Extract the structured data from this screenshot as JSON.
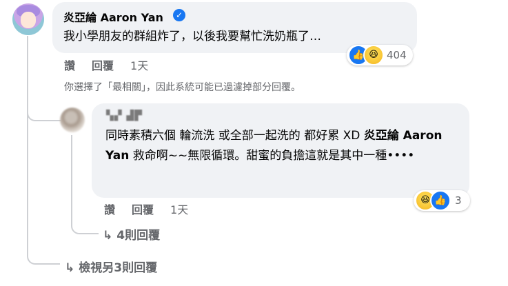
{
  "comment1": {
    "author": "炎亞綸 Aaron Yan",
    "text": "我小學朋友的群組炸了，以後我要幫忙洗奶瓶了…",
    "reaction_count": "404",
    "actions": {
      "like": "讚",
      "reply": "回覆",
      "time": "1天"
    }
  },
  "notice": "你選擇了「最相關」，因此系統可能已過濾掉部分回覆。",
  "comment2": {
    "author": "​",
    "text_part1": "同時素積六個 輪流洗 或全部一起洗的 都好累 XD ",
    "tag": "炎亞綸 Aaron Yan",
    "text_part2": " 救命啊~~無限循環。甜蜜的負擔這就是其中一種••••",
    "reaction_count": "3",
    "actions": {
      "like": "讚",
      "reply": "回覆",
      "time": "1天"
    }
  },
  "replies_link": "4則回覆",
  "view_more_link": "檢視另3則回覆",
  "colors": {
    "like_blue": "#1877f2",
    "muted": "#65676b",
    "bubble": "#f0f2f5"
  },
  "icons": {
    "like": "thumbs-up-icon",
    "haha": "haha-icon",
    "verified": "verified-badge-icon",
    "reply_arrow": "reply-arrow-icon"
  }
}
